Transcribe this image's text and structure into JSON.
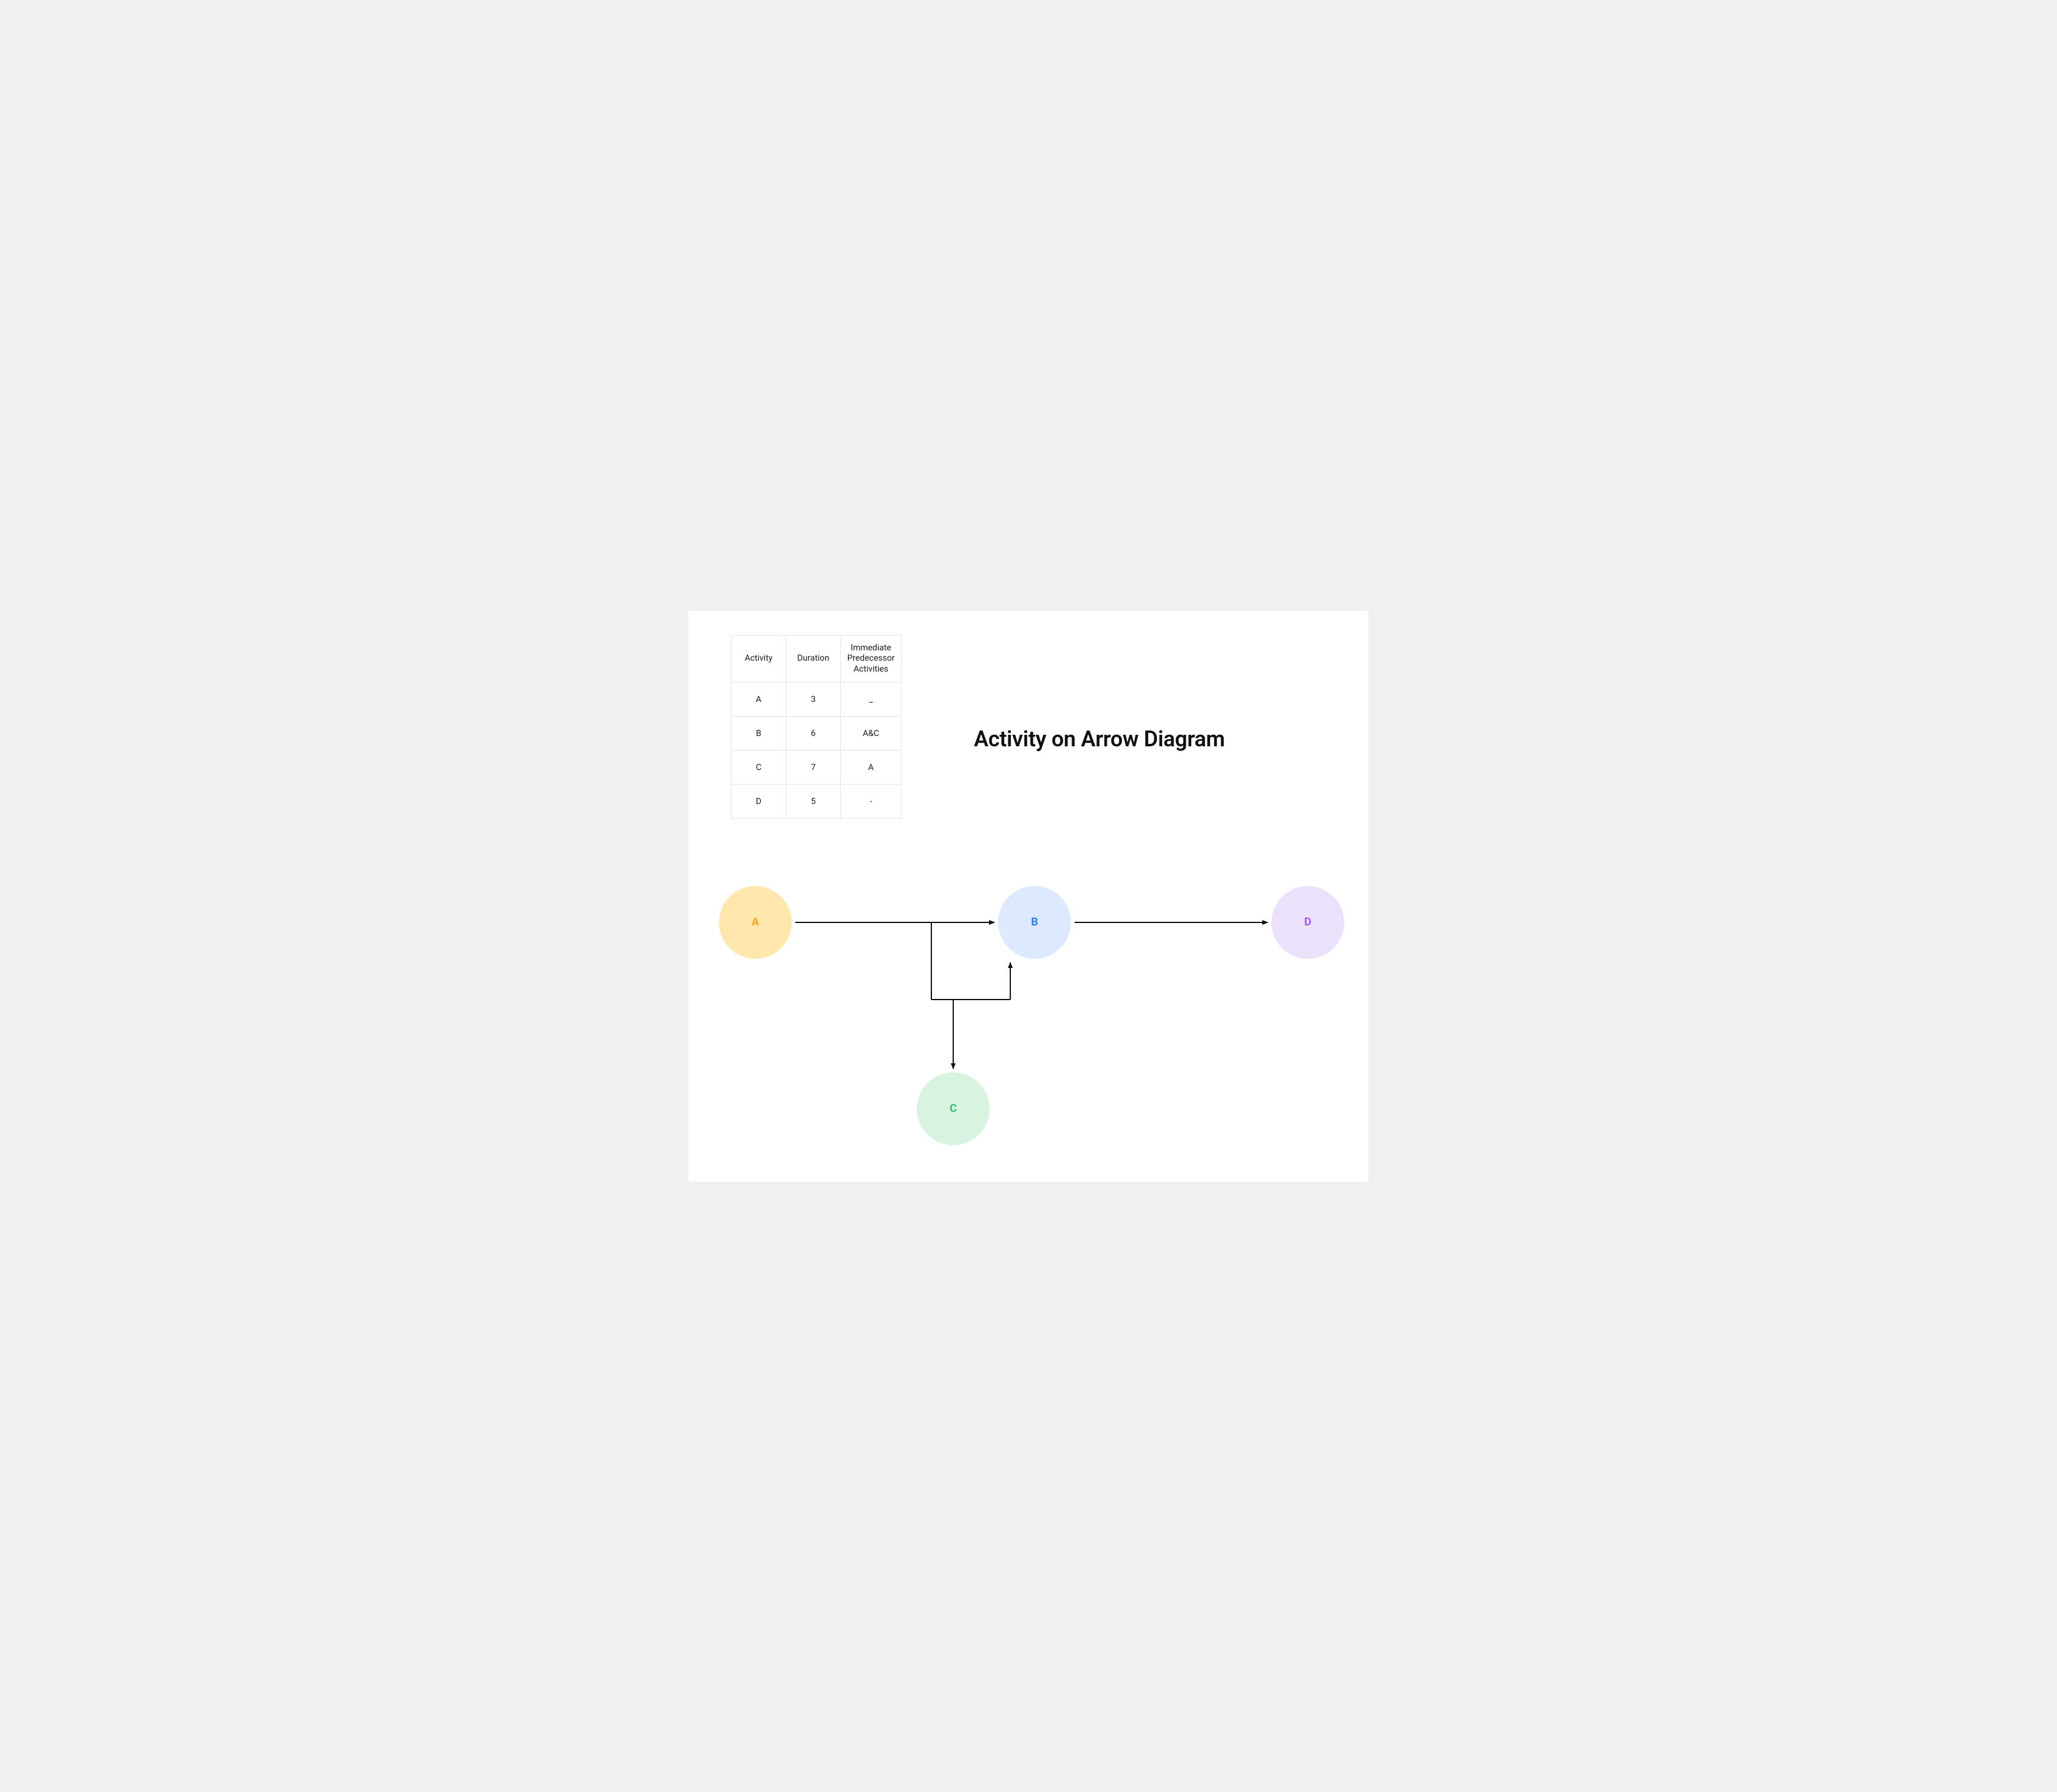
{
  "title": "Activity on Arrow Diagram",
  "table": {
    "headers": {
      "activity": "Activity",
      "duration": "Duration",
      "predecessor": "Immediate Predecessor Activities"
    },
    "rows": [
      {
        "activity": "A",
        "duration": "3",
        "predecessor": "_"
      },
      {
        "activity": "B",
        "duration": "6",
        "predecessor": "A&C"
      },
      {
        "activity": "C",
        "duration": "7",
        "predecessor": "A"
      },
      {
        "activity": "D",
        "duration": "5",
        "predecessor": "-"
      }
    ]
  },
  "nodes": {
    "a": {
      "label": "A"
    },
    "b": {
      "label": "B"
    },
    "c": {
      "label": "C"
    },
    "d": {
      "label": "D"
    }
  }
}
